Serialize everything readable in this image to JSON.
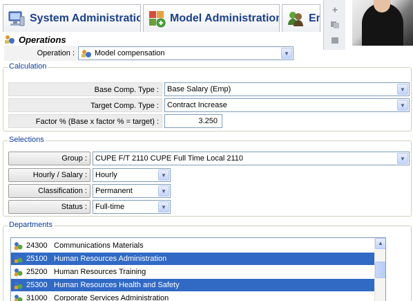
{
  "tabs": [
    {
      "label": "System Administration",
      "icon": "computer-admin-icon"
    },
    {
      "label": "Model Administration",
      "icon": "puzzle-model-icon"
    },
    {
      "label": "Em",
      "icon": "employee-icon"
    }
  ],
  "operations": {
    "title": "Operations",
    "operation_label": "Operation :",
    "operation_value": "Model compensation"
  },
  "calculation": {
    "legend": "Calculation",
    "base_label": "Base Comp. Type :",
    "base_value": "Base Salary (Emp)",
    "target_label": "Target Comp. Type :",
    "target_value": "Contract Increase",
    "factor_label": "Factor % (Base x factor % = target) :",
    "factor_value": "3.250"
  },
  "selections": {
    "legend": "Selections",
    "group_label": "Group :",
    "group_value": "CUPE F/T 2110 CUPE Full Time Local 2110",
    "hourly_label": "Hourly / Salary :",
    "hourly_value": "Hourly",
    "class_label": "Classification :",
    "class_value": "Permanent",
    "status_label": "Status :",
    "status_value": "Full-time"
  },
  "departments": {
    "legend": "Departments",
    "items": [
      {
        "code": "24300",
        "name": "Communications Materials",
        "selected": false
      },
      {
        "code": "25100",
        "name": "Human Resources Administration",
        "selected": true
      },
      {
        "code": "25200",
        "name": "Human Resources Training",
        "selected": false
      },
      {
        "code": "25300",
        "name": "Human Resources Health and Safety",
        "selected": true
      },
      {
        "code": "31000",
        "name": "Corporate Services Administration",
        "selected": false
      }
    ]
  },
  "colors": {
    "tab_text": "#1a3f8c",
    "legend_text": "#0a3c9b",
    "selection_bg": "#316ac5",
    "field_border": "#7f9db9"
  }
}
